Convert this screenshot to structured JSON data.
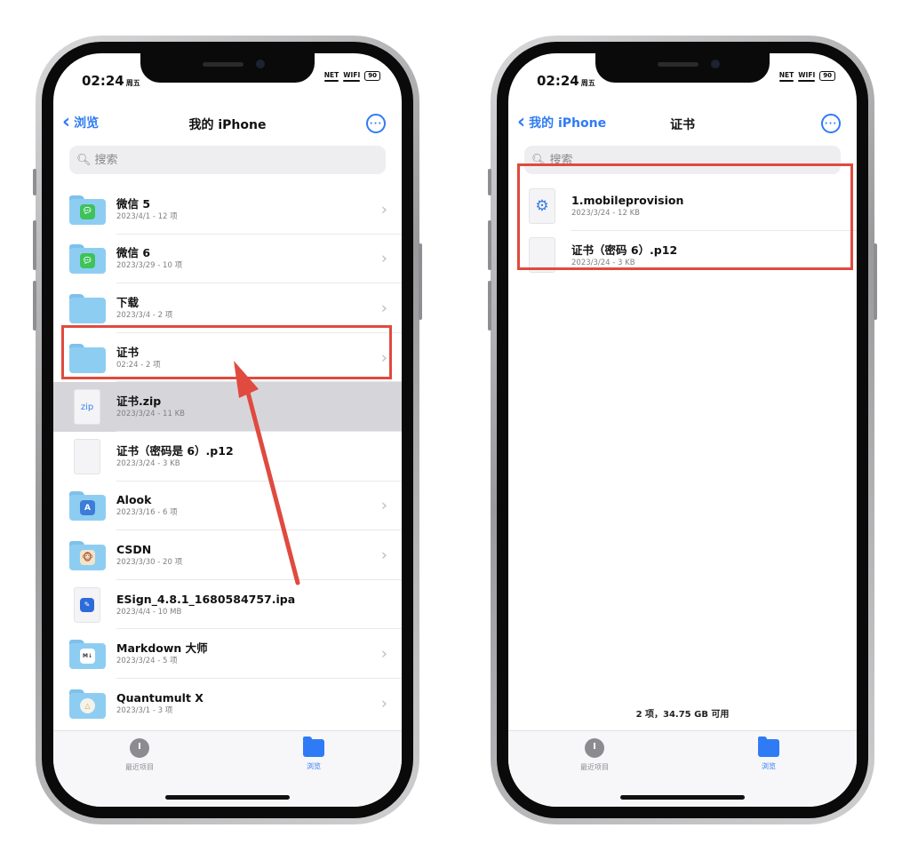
{
  "left": {
    "status": {
      "time": "02:24",
      "weekday": "周五",
      "net": "NET",
      "wifi": "WIFI",
      "battery": "90"
    },
    "nav": {
      "back_label": "浏览",
      "title": "我的 iPhone"
    },
    "search": {
      "placeholder": "搜索"
    },
    "items": [
      {
        "name": "微信 5",
        "meta": "2023/4/1 - 12 项",
        "kind": "folder",
        "badge": "wechat"
      },
      {
        "name": "微信 6",
        "meta": "2023/3/29 - 10 项",
        "kind": "folder",
        "badge": "wechat"
      },
      {
        "name": "下载",
        "meta": "2023/3/4 - 2 项",
        "kind": "folder",
        "badge": ""
      },
      {
        "name": "证书",
        "meta": "02:24 - 2 项",
        "kind": "folder",
        "badge": ""
      },
      {
        "name": "证书.zip",
        "meta": "2023/3/24 - 11 KB",
        "kind": "zip"
      },
      {
        "name": "证书（密码是 6）.p12",
        "meta": "2023/3/24 - 3 KB",
        "kind": "file"
      },
      {
        "name": "Alook",
        "meta": "2023/3/16 - 6 项",
        "kind": "folder",
        "badge": "alook"
      },
      {
        "name": "CSDN",
        "meta": "2023/3/30 - 20 项",
        "kind": "folder",
        "badge": "csdn"
      },
      {
        "name": "ESign_4.8.1_1680584757.ipa",
        "meta": "2023/4/4 - 10 MB",
        "kind": "ipa"
      },
      {
        "name": "Markdown 大师",
        "meta": "2023/3/24 - 5 项",
        "kind": "folder",
        "badge": "md"
      },
      {
        "name": "Quantumult X",
        "meta": "2023/3/1 - 3 项",
        "kind": "folder",
        "badge": "qx"
      }
    ],
    "icons": {
      "zip_label": "zip",
      "alook_glyph": "A",
      "csdn_glyph": "🐵",
      "md_glyph": "M↓",
      "qx_glyph": "△",
      "ipa_glyph": "✎"
    },
    "tabs": [
      {
        "label": "最近项目"
      },
      {
        "label": "浏览"
      }
    ]
  },
  "right": {
    "status": {
      "time": "02:24",
      "weekday": "周五",
      "net": "NET",
      "wifi": "WIFI",
      "battery": "90"
    },
    "nav": {
      "back_label": "我的 iPhone",
      "title": "证书"
    },
    "search": {
      "placeholder": "搜索"
    },
    "items": [
      {
        "name": "1.mobileprovision",
        "meta": "2023/3/24 - 12 KB",
        "kind": "gear"
      },
      {
        "name": "证书（密码 6）.p12",
        "meta": "2023/3/24 - 3 KB",
        "kind": "file"
      }
    ],
    "footer": "2 项，34.75 GB 可用",
    "tabs": [
      {
        "label": "最近项目"
      },
      {
        "label": "浏览"
      }
    ]
  },
  "colors": {
    "accent": "#2f7bf5",
    "highlight": "#e04a3f",
    "folder": "#8ecdf2",
    "wechat": "#3ec25a",
    "selected_row": "#d6d6da"
  }
}
